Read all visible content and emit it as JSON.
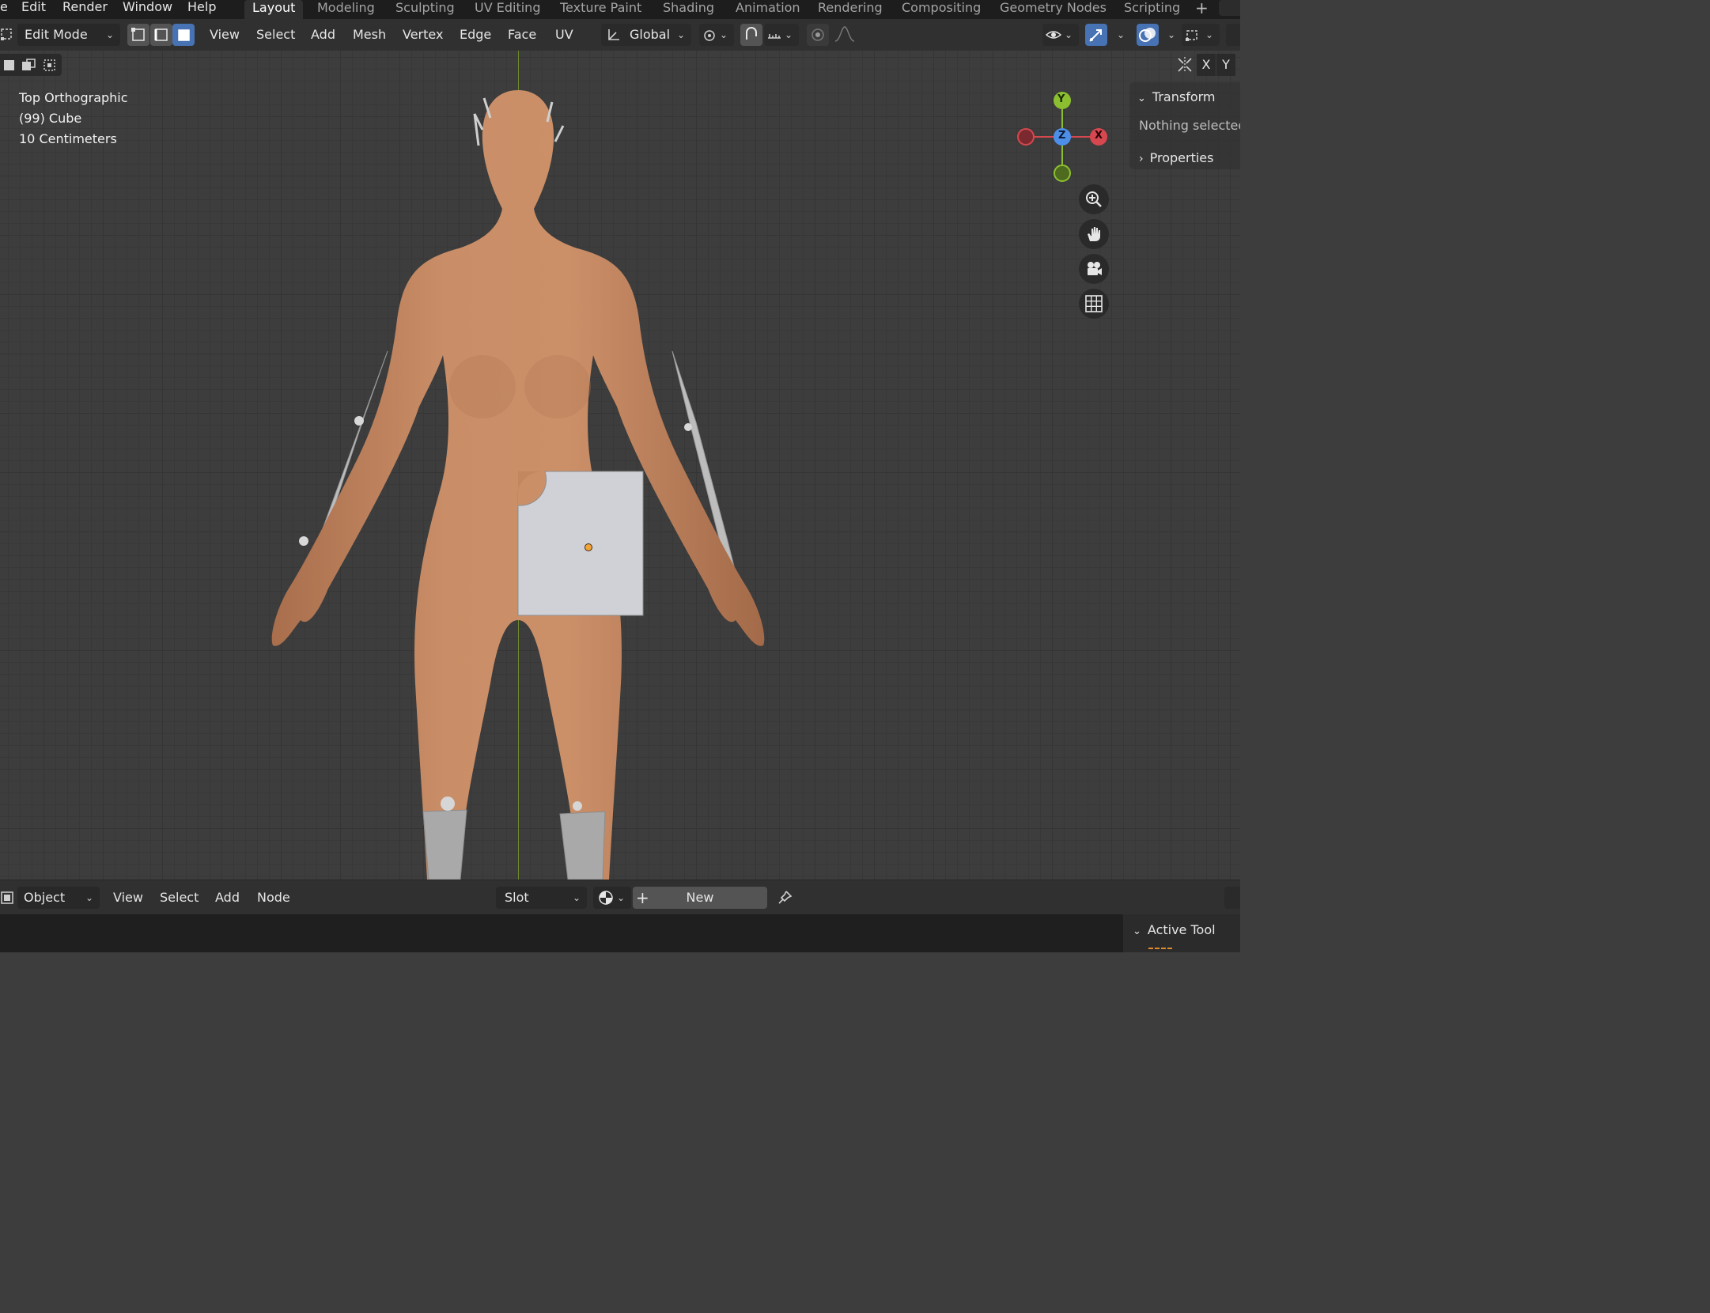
{
  "menu": {
    "items": [
      "e",
      "Edit",
      "Render",
      "Window",
      "Help"
    ]
  },
  "workspaces": {
    "tabs": [
      "Layout",
      "Modeling",
      "Sculpting",
      "UV Editing",
      "Texture Paint",
      "Shading",
      "Animation",
      "Rendering",
      "Compositing",
      "Geometry Nodes",
      "Scripting"
    ],
    "active": "Layout",
    "add_label": "+"
  },
  "header": {
    "mode": "Edit Mode",
    "menus": [
      "View",
      "Select",
      "Add",
      "Mesh",
      "Vertex",
      "Edge",
      "Face",
      "UV"
    ],
    "orientation": "Global"
  },
  "viewport": {
    "view_name": "Top Orthographic",
    "object_info": "(99) Cube",
    "scale_info": "10 Centimeters",
    "gizmo": {
      "y": "Y",
      "z": "Z",
      "x": "X"
    },
    "axis_buttons": [
      "X",
      "Y"
    ]
  },
  "npanel": {
    "transform": "Transform",
    "nothing_selected": "Nothing selected",
    "properties": "Properties"
  },
  "node_header": {
    "mode": "Object",
    "menus": [
      "View",
      "Select",
      "Add",
      "Node"
    ],
    "slot": "Slot",
    "new_label": "New"
  },
  "active_tool": {
    "label": "Active Tool"
  },
  "colors": {
    "accent": "#4772b3",
    "x_axis": "#d7474f",
    "y_axis": "#8cbf30",
    "z_axis": "#4c8ee8",
    "skin": "#c98a64"
  }
}
